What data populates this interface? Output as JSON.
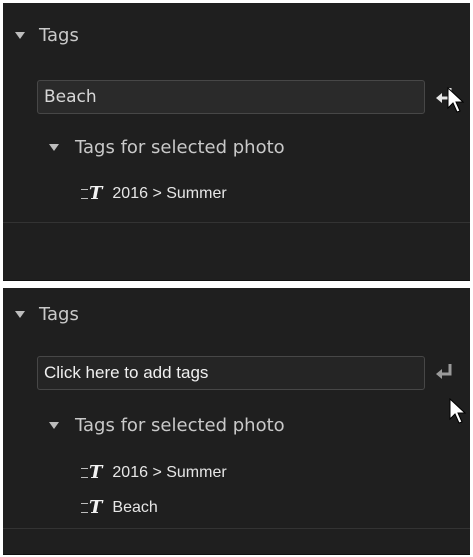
{
  "colors": {
    "panel_bg": "#1f1f1f",
    "text": "#c9c9c9",
    "input_border": "#474747"
  },
  "panels": [
    {
      "header": {
        "label": "Tags",
        "icon": "triangle-down-icon"
      },
      "input": {
        "value": "Beach",
        "placeholder": "Click here to add tags",
        "state": "filled"
      },
      "enter_button": {
        "icon": "enter-arrow-icon",
        "hovered": true
      },
      "subheader": {
        "label": "Tags for selected photo"
      },
      "tags": [
        {
          "label": "2016 > Summer",
          "icon": "tag-icon"
        }
      ]
    },
    {
      "header": {
        "label": "Tags",
        "icon": "triangle-down-icon"
      },
      "input": {
        "value": "",
        "placeholder": "Click here to add tags",
        "state": "placeholder"
      },
      "enter_button": {
        "icon": "enter-arrow-icon",
        "hovered": false
      },
      "subheader": {
        "label": "Tags for selected photo"
      },
      "tags": [
        {
          "label": "2016 > Summer",
          "icon": "tag-icon"
        },
        {
          "label": "Beach",
          "icon": "tag-icon"
        }
      ]
    }
  ]
}
